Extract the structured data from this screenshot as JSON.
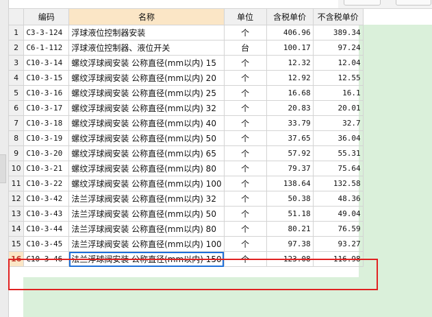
{
  "table": {
    "headers": [
      "编码",
      "名称",
      "单位",
      "含税单价",
      "不含税单价"
    ],
    "rows": [
      {
        "no": "1",
        "code": "C3-3-124",
        "name": "浮球液位控制器安装",
        "unit": "个",
        "tax_price": "406.96",
        "notax_price": "389.34"
      },
      {
        "no": "2",
        "code": "C6-1-112",
        "name": "浮球液位控制器、液位开关",
        "unit": "台",
        "tax_price": "100.17",
        "notax_price": "97.24"
      },
      {
        "no": "3",
        "code": "C10-3-14",
        "name": "螺纹浮球阀安装 公称直径(mm以内) 15",
        "unit": "个",
        "tax_price": "12.32",
        "notax_price": "12.04"
      },
      {
        "no": "4",
        "code": "C10-3-15",
        "name": "螺纹浮球阀安装 公称直径(mm以内) 20",
        "unit": "个",
        "tax_price": "12.92",
        "notax_price": "12.55"
      },
      {
        "no": "5",
        "code": "C10-3-16",
        "name": "螺纹浮球阀安装 公称直径(mm以内) 25",
        "unit": "个",
        "tax_price": "16.68",
        "notax_price": "16.1"
      },
      {
        "no": "6",
        "code": "C10-3-17",
        "name": "螺纹浮球阀安装 公称直径(mm以内) 32",
        "unit": "个",
        "tax_price": "20.83",
        "notax_price": "20.01"
      },
      {
        "no": "7",
        "code": "C10-3-18",
        "name": "螺纹浮球阀安装 公称直径(mm以内) 40",
        "unit": "个",
        "tax_price": "33.79",
        "notax_price": "32.7"
      },
      {
        "no": "8",
        "code": "C10-3-19",
        "name": "螺纹浮球阀安装 公称直径(mm以内) 50",
        "unit": "个",
        "tax_price": "37.65",
        "notax_price": "36.04"
      },
      {
        "no": "9",
        "code": "C10-3-20",
        "name": "螺纹浮球阀安装 公称直径(mm以内) 65",
        "unit": "个",
        "tax_price": "57.92",
        "notax_price": "55.31"
      },
      {
        "no": "10",
        "code": "C10-3-21",
        "name": "螺纹浮球阀安装 公称直径(mm以内) 80",
        "unit": "个",
        "tax_price": "79.37",
        "notax_price": "75.64"
      },
      {
        "no": "11",
        "code": "C10-3-22",
        "name": "螺纹浮球阀安装 公称直径(mm以内) 100",
        "unit": "个",
        "tax_price": "138.64",
        "notax_price": "132.58"
      },
      {
        "no": "12",
        "code": "C10-3-42",
        "name": "法兰浮球阀安装 公称直径(mm以内) 32",
        "unit": "个",
        "tax_price": "50.38",
        "notax_price": "48.36"
      },
      {
        "no": "13",
        "code": "C10-3-43",
        "name": "法兰浮球阀安装 公称直径(mm以内) 50",
        "unit": "个",
        "tax_price": "51.18",
        "notax_price": "49.04"
      },
      {
        "no": "14",
        "code": "C10-3-44",
        "name": "法兰浮球阀安装 公称直径(mm以内) 80",
        "unit": "个",
        "tax_price": "80.21",
        "notax_price": "76.59"
      },
      {
        "no": "15",
        "code": "C10-3-45",
        "name": "法兰浮球阀安装 公称直径(mm以内) 100",
        "unit": "个",
        "tax_price": "97.38",
        "notax_price": "93.27"
      },
      {
        "no": "16",
        "code": "C10-3-46",
        "name": "法兰浮球阀安装 公称直径(mm以内) 150",
        "unit": "个",
        "tax_price": "123.08",
        "notax_price": "116.98",
        "selected": true
      }
    ]
  },
  "colors": {
    "selection_outline": "#1e6fd9",
    "highlight_box": "#e02020",
    "background_green": "#daf0da",
    "header_highlight": "#fbe6c6"
  }
}
